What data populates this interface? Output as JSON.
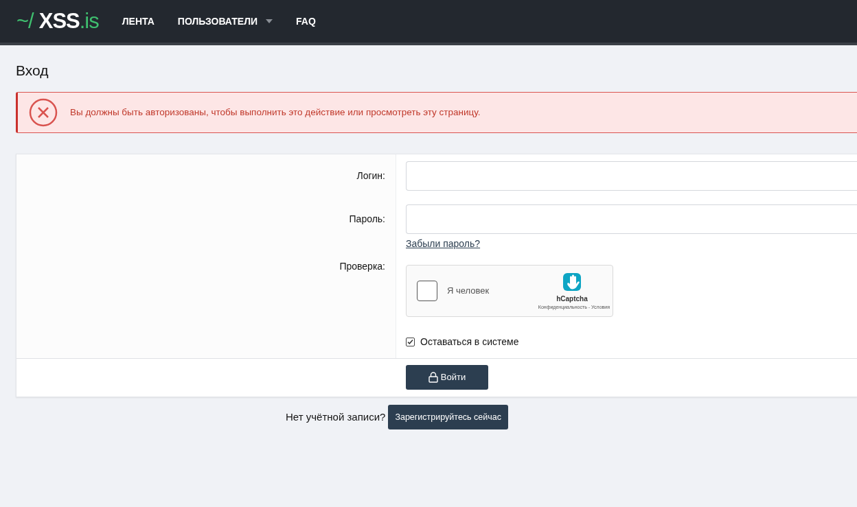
{
  "navbar": {
    "logo": {
      "prefix": "~/",
      "name": "XSS",
      "suffix": ".is"
    },
    "items": [
      {
        "label": "ЛЕНТА",
        "dropdown": false
      },
      {
        "label": "ПОЛЬЗОВАТЕЛИ",
        "dropdown": true
      },
      {
        "label": "FAQ",
        "dropdown": false
      }
    ]
  },
  "page_title": "Вход",
  "alert": {
    "kind": "error",
    "message": "Вы должны быть авторизованы, чтобы выполнить это действие или просмотреть эту страницу."
  },
  "form": {
    "fields": [
      {
        "kind": "text",
        "label": "Логин:"
      },
      {
        "kind": "password",
        "label": "Пароль:",
        "link": "Забыли пароль?"
      },
      {
        "kind": "captcha",
        "label": "Проверка:",
        "captcha": {
          "checked": false,
          "text": "Я человек",
          "brand": "hCaptcha",
          "links": "Конфиденциальность - Условия"
        }
      }
    ],
    "remember": {
      "label": "Оставаться в системе",
      "checked": true
    },
    "submit": "Войти"
  },
  "register": {
    "prompt": "Нет учётной записи?",
    "button": "Зарегистрируйтесь сейчас"
  }
}
